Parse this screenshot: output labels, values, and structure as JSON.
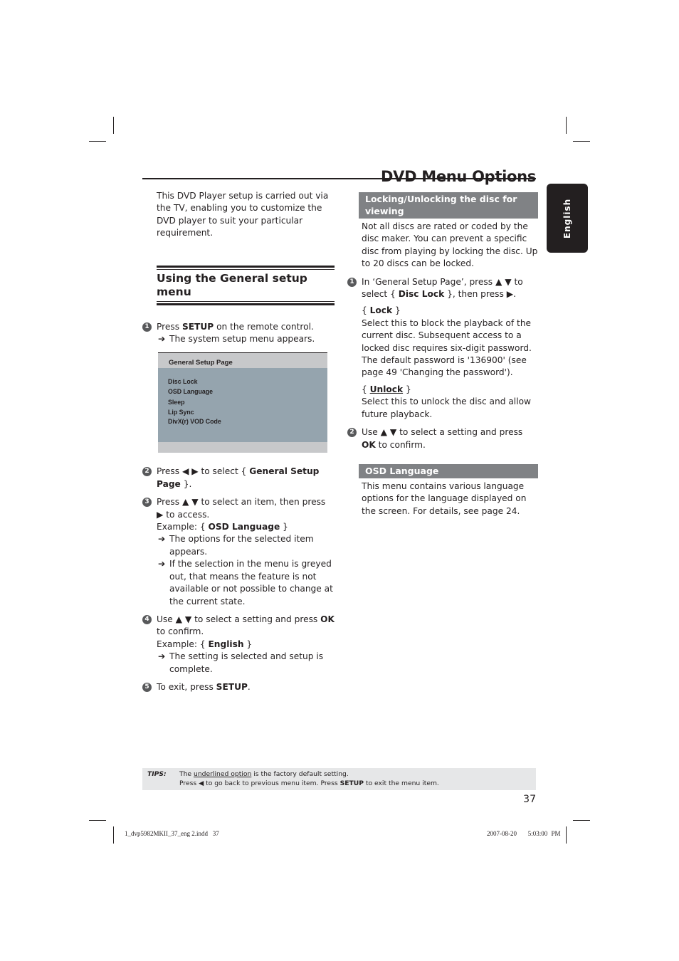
{
  "page": {
    "title": "DVD Menu Options",
    "language_tab": "English",
    "page_number": "37"
  },
  "left": {
    "intro": "This DVD Player setup is carried out via the TV, enabling you to customize the DVD player to suit your particular requirement.",
    "section_title": "Using the General setup menu",
    "steps": [
      {
        "num": "1",
        "parts": [
          "Press ",
          "SETUP",
          " on the remote control."
        ],
        "result": "The system setup menu appears."
      },
      {
        "num": "2",
        "parts": [
          "Press ◀ ▶ to select { ",
          "General Setup Page",
          " }."
        ]
      },
      {
        "num": "3",
        "parts": [
          "Press ▲ ▼ to select an item, then press ▶ to access."
        ],
        "example_label": "Example: { ",
        "example_value": "OSD Language",
        "example_end": " }",
        "results": [
          "The options for the selected item appears.",
          "If the selection in the menu is greyed out, that means the feature is not available or not possible to change at the current state."
        ]
      },
      {
        "num": "4",
        "parts": [
          "Use ▲ ▼ to select a setting and press ",
          "OK",
          " to confirm."
        ],
        "example_label": "Example: { ",
        "example_value": "English",
        "example_end": " }",
        "results": [
          "The setting is selected and setup is complete."
        ]
      },
      {
        "num": "5",
        "parts": [
          "To exit, press ",
          "SETUP",
          "."
        ]
      }
    ],
    "osd_menu": {
      "title": "General Setup Page",
      "items": [
        "Disc Lock",
        "OSD Language",
        "Sleep",
        "Lip Sync",
        "DivX(r) VOD Code"
      ]
    }
  },
  "right": {
    "section1_title": "Locking/Unlocking the disc for viewing",
    "section1_intro": "Not all discs are rated or coded by the disc maker. You can prevent a specific disc from playing by locking the disc. Up to 20 discs can be locked.",
    "step1": {
      "num": "1",
      "pre": "In ‘General Setup Page’, press ▲ ▼ to select { ",
      "bold": "Disc Lock",
      "post": " }, then press ▶."
    },
    "option_lock": {
      "label": "Lock",
      "desc": "Select this to block the playback of the current disc. Subsequent access to a locked disc requires six-digit password. The default password is '136900' (see page 49 'Changing the password')."
    },
    "option_unlock": {
      "label": "Unlock",
      "desc": "Select this to unlock the disc and allow future playback."
    },
    "step2": {
      "num": "2",
      "pre": "Use ▲ ▼ to select a setting and press ",
      "bold": "OK",
      "post": " to confirm."
    },
    "section2_title": "OSD Language",
    "section2_text": "This menu contains various language options for the language displayed on the screen. For details, see page 24."
  },
  "tips": {
    "label": "TIPS:",
    "line1_pre": "The ",
    "line1_underlined": "underlined option",
    "line1_post": " is the factory default setting.",
    "line2_pre": "Press ◀ to go back to previous menu item. Press ",
    "line2_bold": "SETUP",
    "line2_post": " to exit the menu item."
  },
  "footer": {
    "file": "1_dvp5982MKII_37_eng 2.indd   37",
    "timestamp": "2007-08-20   5:03:00 PM"
  }
}
